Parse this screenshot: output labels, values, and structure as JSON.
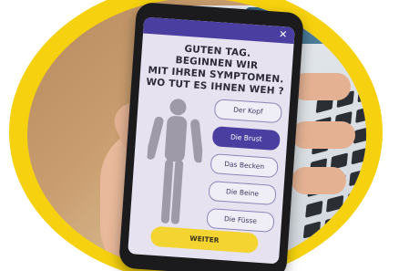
{
  "app": {
    "headline_line1": "GUTEN TAG.",
    "headline_line2": "BEGINNEN WIR",
    "headline_line3": "MIT IHREN SYMPTOMEN.",
    "headline_line4": "WO TUT ES IHNEN WEH ?"
  },
  "options": [
    {
      "label": "Der Kopf",
      "selected": false
    },
    {
      "label": "Die Brust",
      "selected": true
    },
    {
      "label": "Das Becken",
      "selected": false
    },
    {
      "label": "Die Beine",
      "selected": false
    },
    {
      "label": "Die Füsse",
      "selected": false
    }
  ],
  "actions": {
    "next_label": "WEITER"
  },
  "colors": {
    "accent": "#4a3fa0",
    "button": "#f4d430",
    "ring": "#f5d10f"
  },
  "icons": {
    "close": "close-icon",
    "body": "human-body-icon"
  }
}
